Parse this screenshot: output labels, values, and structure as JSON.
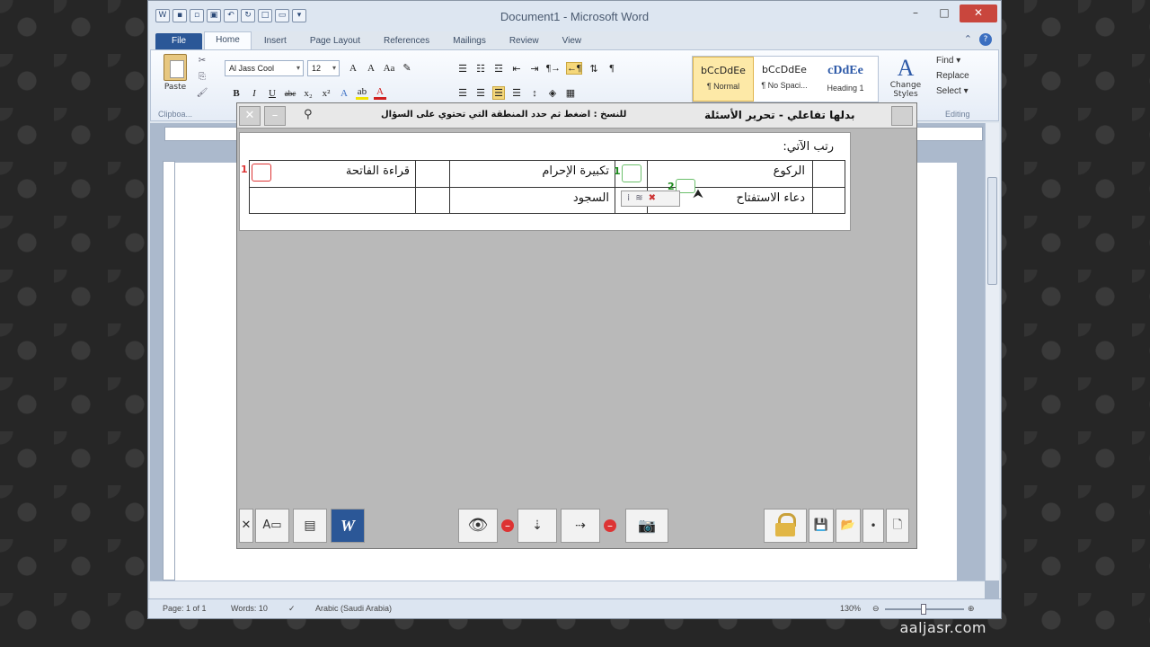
{
  "window": {
    "title": "Document1 - Microsoft Word",
    "controls": {
      "minimize": "▭",
      "maximize": "□",
      "close": "✕"
    }
  },
  "quick_access": [
    "W",
    "💾",
    "📁",
    "🖼",
    "↶",
    "↻",
    "□",
    "▭",
    "▾"
  ],
  "tabs": [
    "File",
    "Home",
    "Insert",
    "Page Layout",
    "References",
    "Mailings",
    "Review",
    "View"
  ],
  "active_tab": "Home",
  "ribbon": {
    "paste_label": "Paste",
    "clipboard_group": "Clipboa...",
    "font_name": "Al Jass Cool",
    "font_size": "12",
    "font_buttons": [
      "A",
      "A",
      "Aa",
      "✎"
    ],
    "format_buttons": [
      "B",
      "I",
      "U",
      "abc",
      "x₂",
      "x²"
    ],
    "styles": [
      {
        "preview": "bCcDdEe",
        "name": "¶ Normal"
      },
      {
        "preview": "bCcDdEe",
        "name": "¶ No Spaci..."
      },
      {
        "preview": "cDdEe",
        "name": "Heading 1"
      }
    ],
    "change_styles": "Change Styles",
    "editing": {
      "find": "Find ▾",
      "replace": "Replace",
      "select": "Select ▾",
      "group": "Editing"
    }
  },
  "status": {
    "page": "Page: 1 of 1",
    "words": "Words: 10",
    "language": "Arabic (Saudi Arabia)",
    "zoom": "130%"
  },
  "dialog": {
    "title": "بدلها تفاعلي - تحرير الأسئلة",
    "hint": "للنسخ : اضغط ثم حدد المنطقة التي تحتوي على السؤال",
    "question": "رتب الآتي:",
    "table": {
      "row1": {
        "col_a": "الركوع",
        "col_b": "تكبيرة الإحرام",
        "col_c": "قراءة الفاتحة"
      },
      "row2": {
        "col_a": "دعاء الاستفتاح",
        "col_b": "السجود"
      }
    },
    "marker_numbers": {
      "takbira": "1",
      "fatiha": "1",
      "dragging": "2"
    }
  },
  "watermark": "aaljasr.com"
}
